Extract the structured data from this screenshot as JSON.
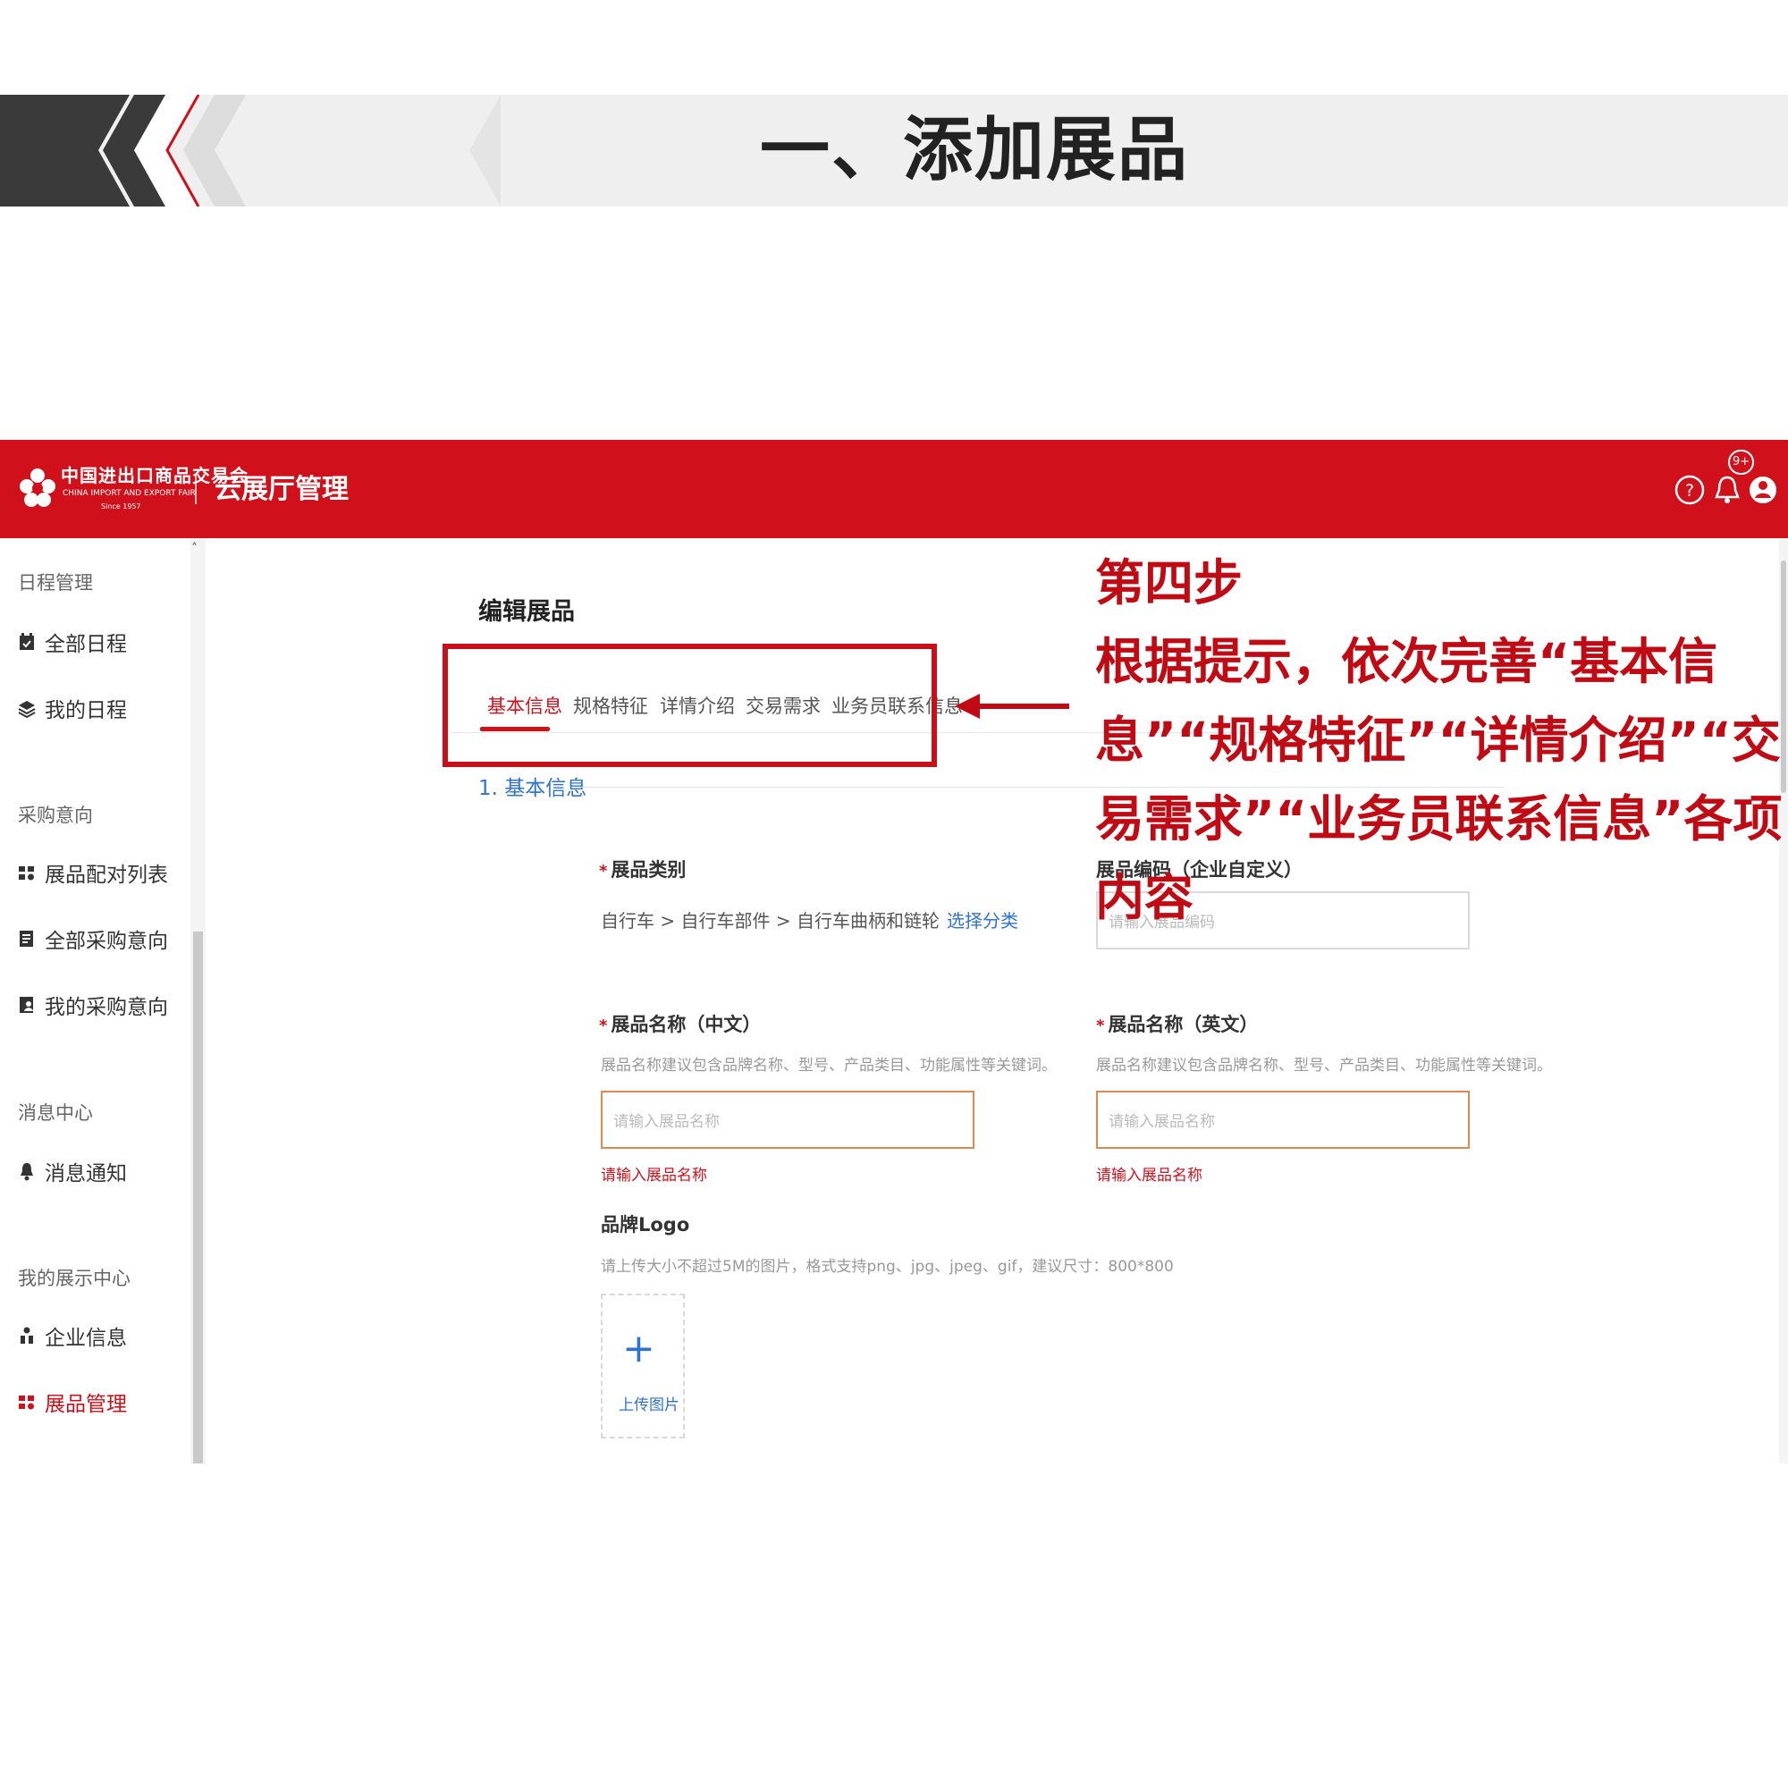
{
  "slide": {
    "title": "一、添加展品"
  },
  "app": {
    "logo": {
      "name_cn": "中国进出口商品交易会",
      "name_en": "CHINA IMPORT AND EXPORT FAIR",
      "since": "Since 1957"
    },
    "title": "云展厅管理",
    "header_icons": [
      "help-icon",
      "bell-icon",
      "user-icon"
    ],
    "notification_badge": "9+",
    "brand_color": "#d0111b"
  },
  "sidebar": {
    "groups": [
      {
        "title": "日程管理",
        "items": [
          {
            "label": "全部日程",
            "icon": "calendar-check-icon"
          },
          {
            "label": "我的日程",
            "icon": "layers-icon"
          }
        ]
      },
      {
        "title": "采购意向",
        "items": [
          {
            "label": "展品配对列表",
            "icon": "grid-match-icon"
          },
          {
            "label": "全部采购意向",
            "icon": "list-doc-icon"
          },
          {
            "label": "我的采购意向",
            "icon": "doc-user-icon"
          }
        ]
      },
      {
        "title": "消息中心",
        "items": [
          {
            "label": "消息通知",
            "icon": "bell-icon"
          }
        ]
      },
      {
        "title": "我的展示中心",
        "items": [
          {
            "label": "企业信息",
            "icon": "org-icon"
          },
          {
            "label": "展品管理",
            "icon": "grid-match-icon",
            "active": true
          }
        ]
      }
    ]
  },
  "main": {
    "heading": "编辑展品",
    "tabs": [
      {
        "label": "基本信息",
        "active": true
      },
      {
        "label": "规格特征"
      },
      {
        "label": "详情介绍"
      },
      {
        "label": "交易需求"
      },
      {
        "label": "业务员联系信息"
      }
    ],
    "section_title": "1. 基本信息",
    "fields": {
      "category": {
        "label": "展品类别",
        "required": true,
        "value": "自行车 > 自行车部件 > 自行车曲柄和链轮",
        "link": "选择分类"
      },
      "code": {
        "label": "展品编码（企业自定义）",
        "placeholder": "请输入展品编码"
      },
      "name_cn": {
        "label": "展品名称（中文）",
        "required": true,
        "hint": "展品名称建议包含品牌名称、型号、产品类目、功能属性等关键词。",
        "placeholder": "请输入展品名称",
        "error": "请输入展品名称"
      },
      "name_en": {
        "label": "展品名称（英文）",
        "required": true,
        "hint": "展品名称建议包含品牌名称、型号、产品类目、功能属性等关键词。",
        "placeholder": "请输入展品名称",
        "error": "请输入展品名称"
      },
      "brand_logo": {
        "label": "品牌Logo",
        "hint": "请上传大小不超过5M的图片，格式支持png、jpg、jpeg、gif，建议尺寸：800*800",
        "upload_label": "上传图片"
      }
    }
  },
  "annotation": {
    "step": "第四步",
    "text": "根据提示，依次完善“基本信息”“规格特征”“详情介绍”“交易需求”“业务员联系信息”各项内容",
    "color": "#c00a14"
  }
}
